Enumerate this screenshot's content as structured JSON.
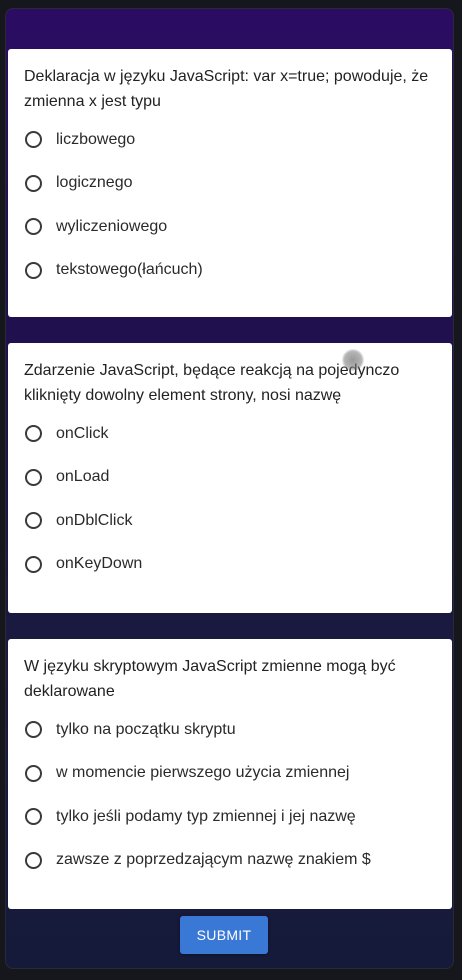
{
  "quiz": {
    "questions": [
      {
        "text": "Deklaracja w języku JavaScript: var x=true; powoduje, że zmienna x jest typu",
        "options": [
          "liczbowego",
          "logicznego",
          "wyliczeniowego",
          "tekstowego(łańcuch)"
        ]
      },
      {
        "text": "Zdarzenie JavaScript, będące reakcją na pojedynczo kliknięty dowolny element strony, nosi nazwę",
        "options": [
          "onClick",
          "onLoad",
          "onDblClick",
          "onKeyDown"
        ]
      },
      {
        "text": "W języku skryptowym JavaScript zmienne mogą być deklarowane",
        "options": [
          "tylko na początku skryptu",
          "w momencie pierwszego użycia zmiennej",
          "tylko jeśli podamy typ zmiennej i jej nazwę",
          "zawsze z poprzedzającym nazwę znakiem $"
        ]
      }
    ],
    "submit_label": "SUBMIT"
  },
  "colors": {
    "header_purple": "#2b0c63",
    "submit_blue": "#3a78d6"
  }
}
